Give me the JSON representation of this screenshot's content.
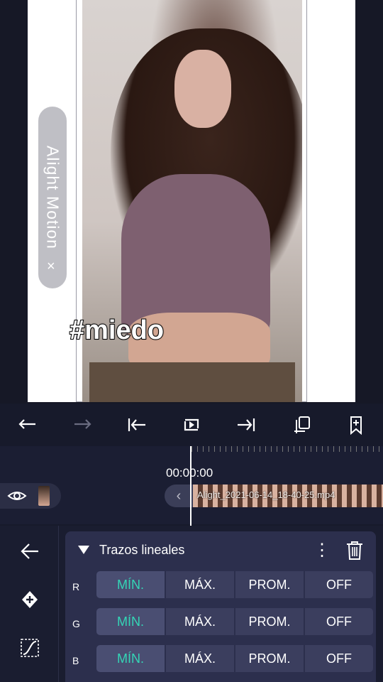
{
  "preview": {
    "watermark_text": "Alight Motion",
    "watermark_close": "×",
    "hashtag": "#miedo"
  },
  "toolbar": {
    "items": [
      "undo-icon",
      "redo-icon",
      "jump-start-icon",
      "loop-play-icon",
      "jump-end-icon",
      "copy-frame-icon",
      "bookmark-add-icon"
    ]
  },
  "timeline": {
    "timecode": "00:00:00",
    "clip_back": "‹",
    "clip_name": "Alight_2021-06-14_18-40-25.mp4"
  },
  "panel": {
    "title": "Trazos lineales",
    "menu": "⋮",
    "rows": [
      {
        "label": "R",
        "options": [
          "MÍN.",
          "MÁX.",
          "PROM.",
          "OFF"
        ],
        "selected": "MÍN."
      },
      {
        "label": "G",
        "options": [
          "MÍN.",
          "MÁX.",
          "PROM.",
          "OFF"
        ],
        "selected": "MÍN."
      },
      {
        "label": "B",
        "options": [
          "MÍN.",
          "MÁX.",
          "PROM.",
          "OFF"
        ],
        "selected": "MÍN."
      }
    ]
  },
  "colors": {
    "accent": "#34d6b6",
    "panel_bg": "#2c2f4d",
    "app_bg": "#1a1d30"
  }
}
